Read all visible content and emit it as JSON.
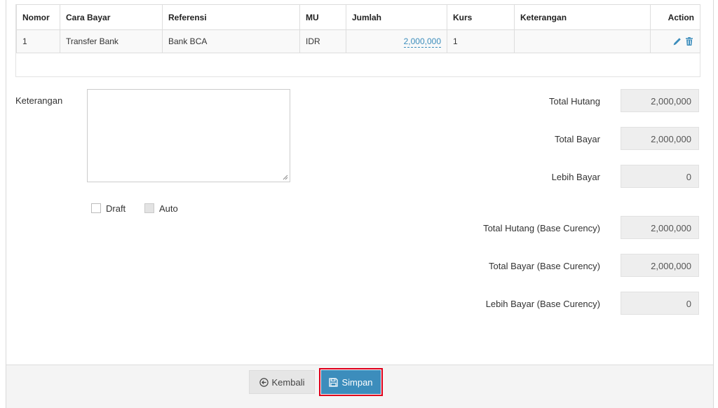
{
  "table": {
    "headers": [
      "Nomor",
      "Cara Bayar",
      "Referensi",
      "MU",
      "Jumlah",
      "Kurs",
      "Keterangan",
      "Action"
    ],
    "rows": [
      {
        "nomor": "1",
        "cara_bayar": "Transfer Bank",
        "referensi": "Bank BCA",
        "mu": "IDR",
        "jumlah": "2,000,000",
        "kurs": "1",
        "keterangan": ""
      }
    ]
  },
  "form": {
    "keterangan_label": "Keterangan",
    "keterangan_value": "",
    "draft_label": "Draft",
    "auto_label": "Auto"
  },
  "summary": {
    "total_hutang_label": "Total Hutang",
    "total_hutang": "2,000,000",
    "total_bayar_label": "Total Bayar",
    "total_bayar": "2,000,000",
    "lebih_bayar_label": "Lebih Bayar",
    "lebih_bayar": "0",
    "total_hutang_base_label": "Total Hutang (Base Curency)",
    "total_hutang_base": "2,000,000",
    "total_bayar_base_label": "Total Bayar (Base Curency)",
    "total_bayar_base": "2,000,000",
    "lebih_bayar_base_label": "Lebih Bayar (Base Curency)",
    "lebih_bayar_base": "0"
  },
  "footer": {
    "back_label": "Kembali",
    "save_label": "Simpan"
  },
  "icons": {
    "edit": "pencil-icon",
    "delete": "trash-icon",
    "back": "circle-arrow-left-icon",
    "save": "floppy-disk-icon"
  },
  "colors": {
    "accent": "#3c8dbc",
    "highlight": "#e0001b"
  }
}
